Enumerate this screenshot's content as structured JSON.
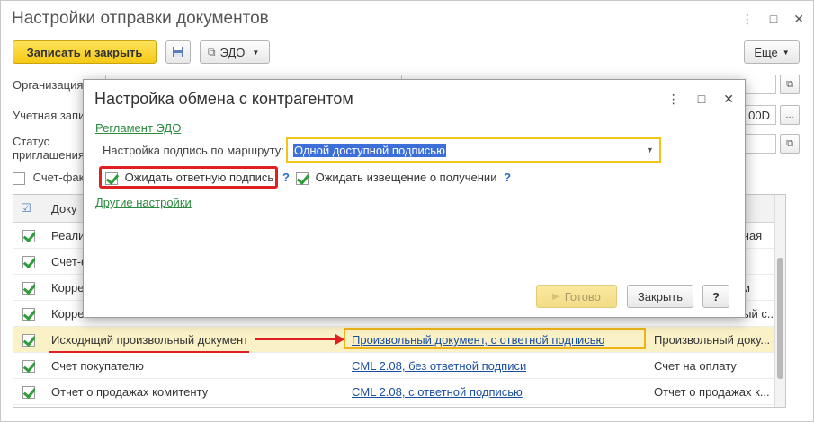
{
  "window": {
    "title": "Настройки отправки документов",
    "controls": [
      "⋮",
      "□",
      "✕"
    ]
  },
  "toolbar": {
    "save_close": "Записать и закрыть",
    "edo": "ЭДО",
    "more": "Еще"
  },
  "form": {
    "org_label": "Организация",
    "account_label": "Учетная запи",
    "status_label_1": "Статус",
    "status_label_2": "приглашения",
    "invoice_label": "Счет-фак",
    "partial_value": "00D"
  },
  "dialog": {
    "title": "Настройка обмена с контрагентом",
    "reglament_link": "Регламент ЭДО",
    "route_label": "Настройка подпись по маршруту:",
    "route_value": "Одной доступной подписью",
    "wait_signature": "Ожидать ответную подпись",
    "wait_notice": "Ожидать извещение о получении",
    "help_mark": "?",
    "other_settings": "Другие настройки",
    "ok_button": "Готово",
    "close_button": "Закрыть",
    "help_button": "?"
  },
  "table": {
    "header_col": "Доку",
    "header_right": "",
    "rows": [
      {
        "checked": true,
        "doc": "Реали",
        "format": "",
        "right": "чная"
      },
      {
        "checked": true,
        "doc": "Счет-ф",
        "format": "",
        "right": ""
      },
      {
        "checked": true,
        "doc": "Корре",
        "format": "",
        "right": "зм"
      },
      {
        "checked": true,
        "doc": "Корре",
        "format": "",
        "right": "ный с..."
      },
      {
        "checked": true,
        "doc": "Исходящий произвольный документ",
        "format": "Произвольный документ, с ответной подписью",
        "right": "Произвольный доку..."
      },
      {
        "checked": true,
        "doc": "Счет покупателю",
        "format": "CML 2.08, без ответной подписи",
        "right": "Счет на оплату"
      },
      {
        "checked": true,
        "doc": "Отчет о продажах комитенту",
        "format": "CML 2.08, с ответной подписью",
        "right": "Отчет о продажах к..."
      }
    ]
  }
}
